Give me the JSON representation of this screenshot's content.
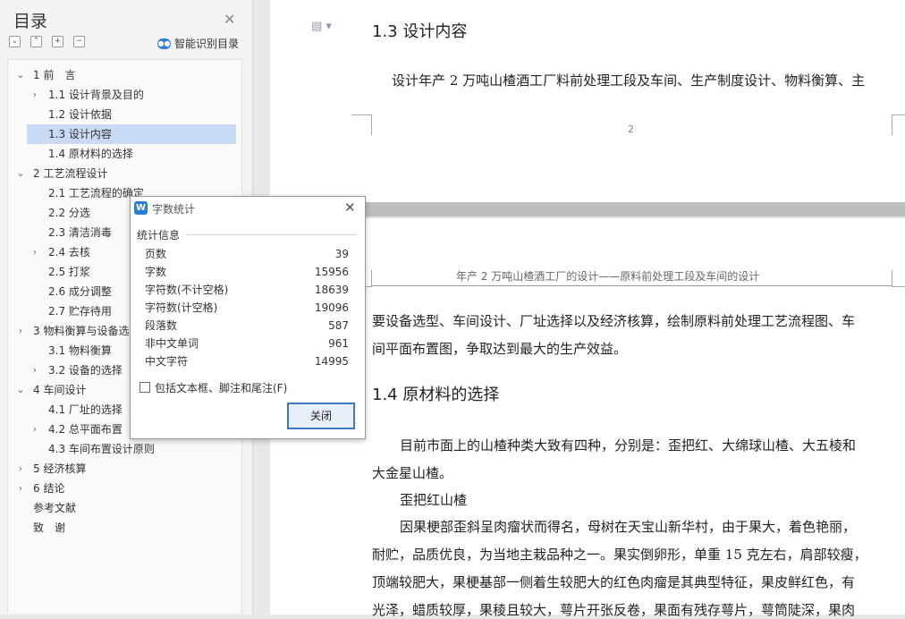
{
  "sidebar": {
    "title": "目录",
    "smart_toc": "智能识别目录",
    "items": [
      {
        "label": "1 前　言",
        "arrow": "v"
      },
      {
        "label": "1.1 设计背景及目的",
        "arrow": ">"
      },
      {
        "label": "1.2 设计依据",
        "arrow": ""
      },
      {
        "label": "1.3 设计内容",
        "arrow": ""
      },
      {
        "label": "1.4 原材料的选择",
        "arrow": ""
      },
      {
        "label": "2 工艺流程设计",
        "arrow": "v"
      },
      {
        "label": "2.1 工艺流程的确定",
        "arrow": ""
      },
      {
        "label": "2.2 分选",
        "arrow": ""
      },
      {
        "label": "2.3 清洁消毒",
        "arrow": ""
      },
      {
        "label": "2.4 去核",
        "arrow": ">"
      },
      {
        "label": "2.5 打浆",
        "arrow": ""
      },
      {
        "label": "2.6 成分调整",
        "arrow": ""
      },
      {
        "label": "2.7 贮存待用",
        "arrow": ""
      },
      {
        "label": "3  物料衡算与设备选型",
        "arrow": ">"
      },
      {
        "label": "3.1 物料衡算",
        "arrow": ""
      },
      {
        "label": "3.2 设备的选择",
        "arrow": ">"
      },
      {
        "label": "4 车间设计",
        "arrow": "v"
      },
      {
        "label": "4.1  厂址的选择",
        "arrow": ""
      },
      {
        "label": "4.2  总平面布置",
        "arrow": ">"
      },
      {
        "label": "4.3  车间布置设计原则",
        "arrow": ""
      },
      {
        "label": "5 经济核算",
        "arrow": ">"
      },
      {
        "label": "6 结论",
        "arrow": ">"
      },
      {
        "label": "参考文献",
        "arrow": ""
      },
      {
        "label": "致　谢",
        "arrow": ""
      }
    ]
  },
  "document": {
    "page1_heading": "1.3 设计内容",
    "page1_para": "设计年产 2 万吨山楂酒工厂料前处理工段及车间、生产制度设计、物料衡算、主",
    "page_number": "2",
    "page2_header": "年产 2 万吨山楂酒工厂的设计——原料前处理工段及车间的设计",
    "line1": "要设备选型、车间设计、厂址选择以及经济核算，绘制原料前处理工艺流程图、车",
    "line2": "间平面布置图，争取达到最大的生产效益。",
    "heading2": "1.4 原材料的选择",
    "line3": "目前市面上的山楂种类大致有四种，分别是：歪把红、大绵球山楂、大五棱和",
    "line4": "大金星山楂。",
    "line5": "歪把红山楂",
    "line6": "因果梗部歪斜呈肉瘤状而得名，母树在天宝山新华村，由于果大，着色艳丽，",
    "line7": "耐贮，品质优良，为当地主栽品种之一。果实倒卵形，单重 15 克左右，肩部较瘦，",
    "line8": "顶端较肥大，果梗基部一侧着生较肥大的红色肉瘤是其典型特征，果皮鲜红色，有",
    "line9": "光泽，蜡质较厚，果稜且较大，萼片开张反卷，果面有残存萼片，萼筒陡深，果肉"
  },
  "dialog": {
    "title": "字数统计",
    "section": "统计信息",
    "stats": [
      {
        "label": "页数",
        "value": "39"
      },
      {
        "label": "字数",
        "value": "15956"
      },
      {
        "label": "字符数(不计空格)",
        "value": "18639"
      },
      {
        "label": "字符数(计空格)",
        "value": "19096"
      },
      {
        "label": "段落数",
        "value": "587"
      },
      {
        "label": "非中文单词",
        "value": "961"
      },
      {
        "label": "中文字符",
        "value": "14995"
      }
    ],
    "checkbox_label": "包括文本框、脚注和尾注(F)",
    "close_button": "关闭"
  }
}
